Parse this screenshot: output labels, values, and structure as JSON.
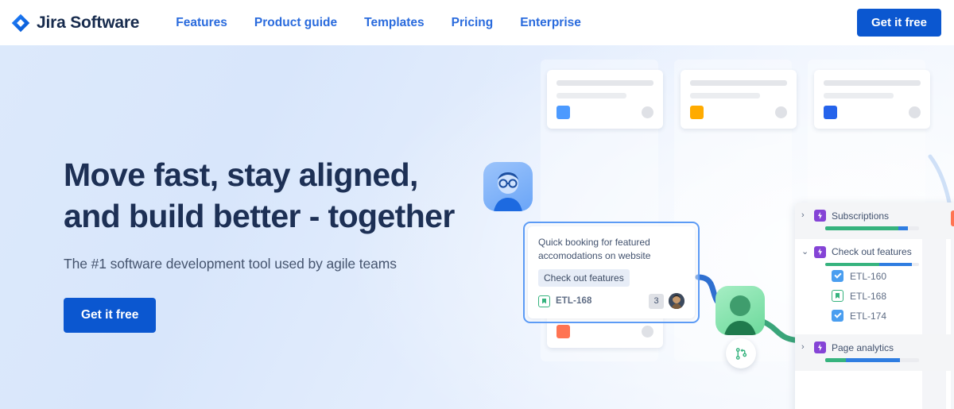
{
  "header": {
    "brand": "Jira Software",
    "logo_icon": "jira-diamond-icon",
    "nav": [
      {
        "label": "Features"
      },
      {
        "label": "Product guide"
      },
      {
        "label": "Templates"
      },
      {
        "label": "Pricing"
      },
      {
        "label": "Enterprise"
      }
    ],
    "cta_label": "Get it free"
  },
  "hero": {
    "headline": "Move fast, stay aligned,\nand build better - together",
    "subheadline": "The #1 software development tool used by agile teams",
    "cta_label": "Get it free"
  },
  "illustration": {
    "skeleton_cards": [
      {
        "tag_color": "#4c9aff",
        "name": "board-card-1"
      },
      {
        "tag_color": "#ffab00",
        "name": "board-card-2"
      },
      {
        "tag_color": "#2563eb",
        "name": "board-card-3"
      },
      {
        "tag_color": "#ff7452",
        "name": "board-card-4"
      }
    ],
    "avatars": [
      {
        "name": "user-avatar-blue",
        "color": "#6aa5f7"
      },
      {
        "name": "user-avatar-green",
        "color": "#6cd99b"
      }
    ],
    "git_badge_icon": "branch-merge-icon",
    "main_card": {
      "title": "Quick booking for featured accomodations on website",
      "chip_label": "Check out features",
      "issue_key": "ETL-168",
      "issue_type_icon": "story-icon",
      "comment_count": "3",
      "assignee_icon": "photo-avatar"
    }
  },
  "panel": {
    "rows": [
      {
        "label": "Subscriptions",
        "icon": "epic-icon",
        "expanded": false,
        "caret": "›",
        "progress": {
          "green_pct": 78,
          "blue_pct": 10
        },
        "timeline_color": "#ff7452",
        "children": []
      },
      {
        "label": "Check out features",
        "icon": "epic-icon",
        "expanded": true,
        "caret": "⌄",
        "progress": {
          "green_pct": 58,
          "blue_pct": 34
        },
        "children": [
          {
            "key": "ETL-160",
            "icon": "task-icon"
          },
          {
            "key": "ETL-168",
            "icon": "story-icon"
          },
          {
            "key": "ETL-174",
            "icon": "task-icon"
          }
        ]
      },
      {
        "label": "Page analytics",
        "icon": "epic-icon",
        "expanded": false,
        "caret": "›",
        "progress": {
          "green_pct": 22,
          "blue_pct": 58
        },
        "children": []
      }
    ]
  },
  "colors": {
    "brand_blue": "#0b57d0",
    "nav_blue": "#2a6bdd",
    "headline_navy": "#1d3055",
    "epic_purple": "#8544d6",
    "progress_green": "#36b37e",
    "progress_blue": "#2f7de1",
    "timeline_orange": "#ff7452"
  }
}
